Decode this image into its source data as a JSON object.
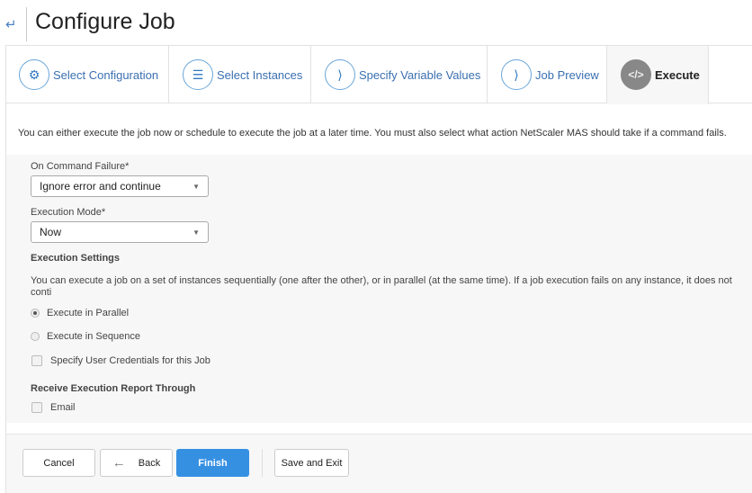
{
  "header": {
    "title": "Configure Job",
    "back_icon": "back-arrow-icon"
  },
  "tabs": [
    {
      "label": "Select Configuration",
      "icon": "gear-icon"
    },
    {
      "label": "Select Instances",
      "icon": "server-stack-icon"
    },
    {
      "label": "Specify Variable Values",
      "icon": "chevron-right-box-icon"
    },
    {
      "label": "Job Preview",
      "icon": "chevron-right-box-icon"
    },
    {
      "label": "Execute",
      "icon": "code-icon",
      "active": true
    }
  ],
  "intro": "You can either execute the job now or schedule to execute the job at a later time. You must also select what action NetScaler MAS should take if a command fails.",
  "form": {
    "failure_label": "On Command Failure*",
    "failure_value": "Ignore error and continue",
    "mode_label": "Execution Mode*",
    "mode_value": "Now",
    "settings_heading": "Execution Settings",
    "settings_desc": "You can execute a job on a set of instances sequentially (one after the other), or in parallel (at the same time). If a job execution fails on any instance, it does not conti",
    "parallel": "Execute in Parallel",
    "sequence": "Execute in Sequence",
    "selected_mode": "parallel",
    "credentials": "Specify User Credentials for this Job",
    "report_heading": "Receive Execution Report Through",
    "email": "Email"
  },
  "footer": {
    "cancel": "Cancel",
    "back": "Back",
    "finish": "Finish",
    "save_exit": "Save and Exit"
  },
  "colors": {
    "accent": "#3590e2",
    "link": "#3a6fb0"
  }
}
